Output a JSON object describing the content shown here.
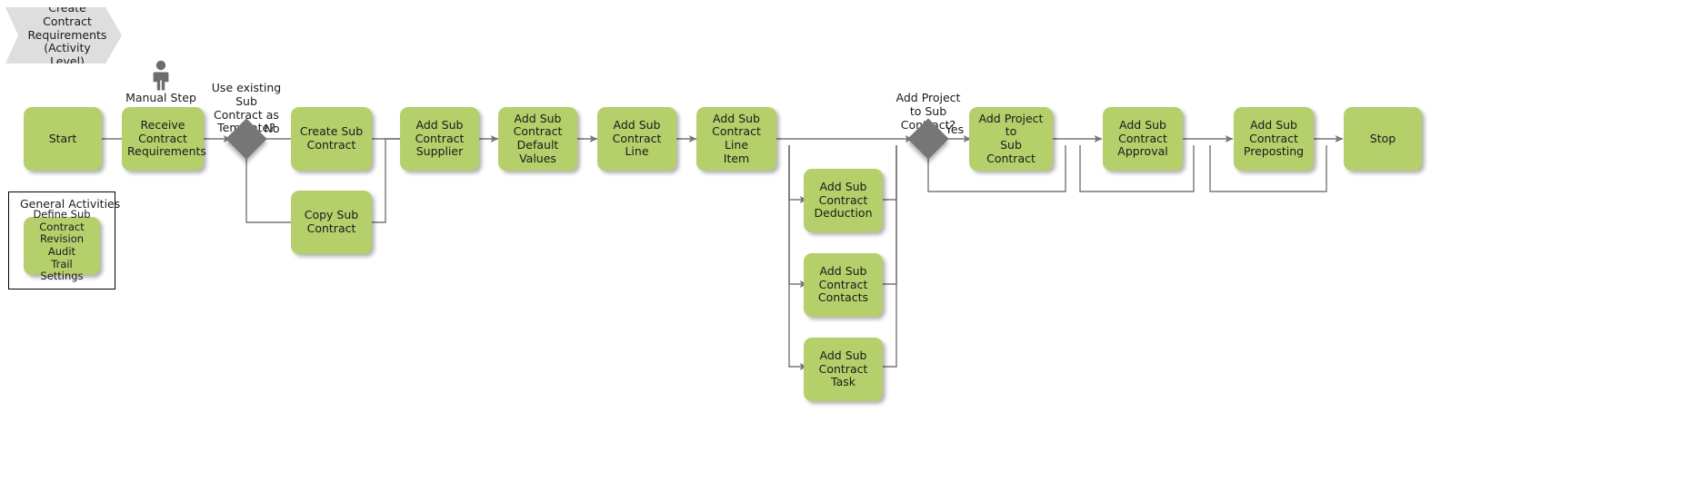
{
  "diagram": {
    "title": "Create Contract Requirements (Activity Level)",
    "banner": {
      "line1": "Create",
      "line2": "Contract",
      "line3": "Requirements",
      "line4": "(Activity Level)"
    },
    "colors": {
      "activity_fill": "#b5cf6b",
      "banner_fill": "#dedede",
      "decision_fill": "#767676",
      "edge_stroke": "#767676",
      "text": "#1a1a1a",
      "group_border": "#000000"
    }
  },
  "captions": {
    "manual_step": "Manual Step"
  },
  "decisions": {
    "use_template": {
      "label_line1": "Use existing",
      "label_line2": "Sub",
      "label_line3": "Contract as",
      "label_line4": "Template?",
      "branch_no": "No"
    },
    "add_project": {
      "label_line1": "Add Project",
      "label_line2": "to Sub",
      "label_line3": "Contract?",
      "branch_yes": "Yes"
    }
  },
  "nodes": {
    "start": "Start",
    "receive_contract_requirements": "Receive\nContract\nRequirements",
    "create_sub_contract": "Create Sub\nContract",
    "copy_sub_contract": "Copy Sub\nContract",
    "add_sub_contract_supplier": "Add Sub\nContract\nSupplier",
    "add_sub_contract_default_values": "Add Sub\nContract Default\nValues",
    "add_sub_contract_line": "Add Sub\nContract Line",
    "add_sub_contract_line_item": "Add Sub\nContract Line\nItem",
    "add_sub_contract_deduction": "Add Sub\nContract\nDeduction",
    "add_sub_contract_contacts": "Add Sub\nContract\nContacts",
    "add_sub_contract_task": "Add Sub\nContract Task",
    "add_project_to_sub_contract": "Add Project to\nSub Contract",
    "add_sub_contract_approval": "Add Sub\nContract\nApproval",
    "add_sub_contract_preposting": "Add Sub\nContract\nPreposting",
    "stop": "Stop"
  },
  "general_activities": {
    "title": "General Activities",
    "items": [
      "Define Sub\nContract\nRevision Audit\nTrail Settings"
    ]
  }
}
